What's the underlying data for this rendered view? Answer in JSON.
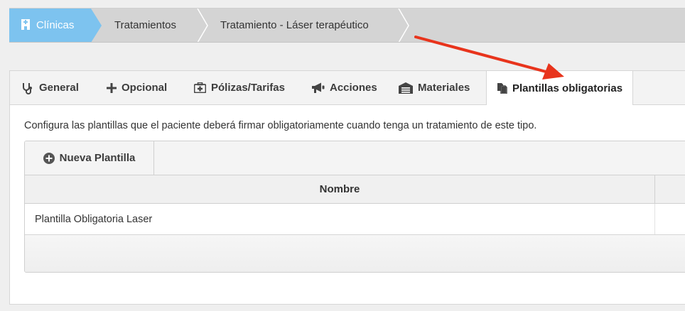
{
  "breadcrumb": {
    "items": [
      {
        "label": "Clínicas",
        "icon": "clinic-building-icon"
      },
      {
        "label": "Tratamientos"
      },
      {
        "label": "Tratamiento - Láser terapéutico"
      }
    ]
  },
  "tabs": [
    {
      "label": "General",
      "icon": "stethoscope-icon"
    },
    {
      "label": "Opcional",
      "icon": "plus-icon"
    },
    {
      "label": "Pólizas/Tarifas",
      "icon": "medkit-icon"
    },
    {
      "label": "Acciones",
      "icon": "megaphone-icon"
    },
    {
      "label": "Materiales",
      "icon": "warehouse-icon"
    },
    {
      "label": "Plantillas obligatorias",
      "icon": "copy-files-icon",
      "active": true
    }
  ],
  "description": "Configura las plantillas que el paciente deberá firmar obligatoriamente cuando tenga un tratamiento de este tipo.",
  "grid": {
    "new_button": "Nueva Plantilla",
    "columns": [
      "Nombre"
    ],
    "rows": [
      [
        "Plantilla Obligatoria Laser"
      ]
    ]
  },
  "colors": {
    "breadcrumb_active": "#7dc3ef",
    "annotation_arrow": "#e8341c"
  }
}
